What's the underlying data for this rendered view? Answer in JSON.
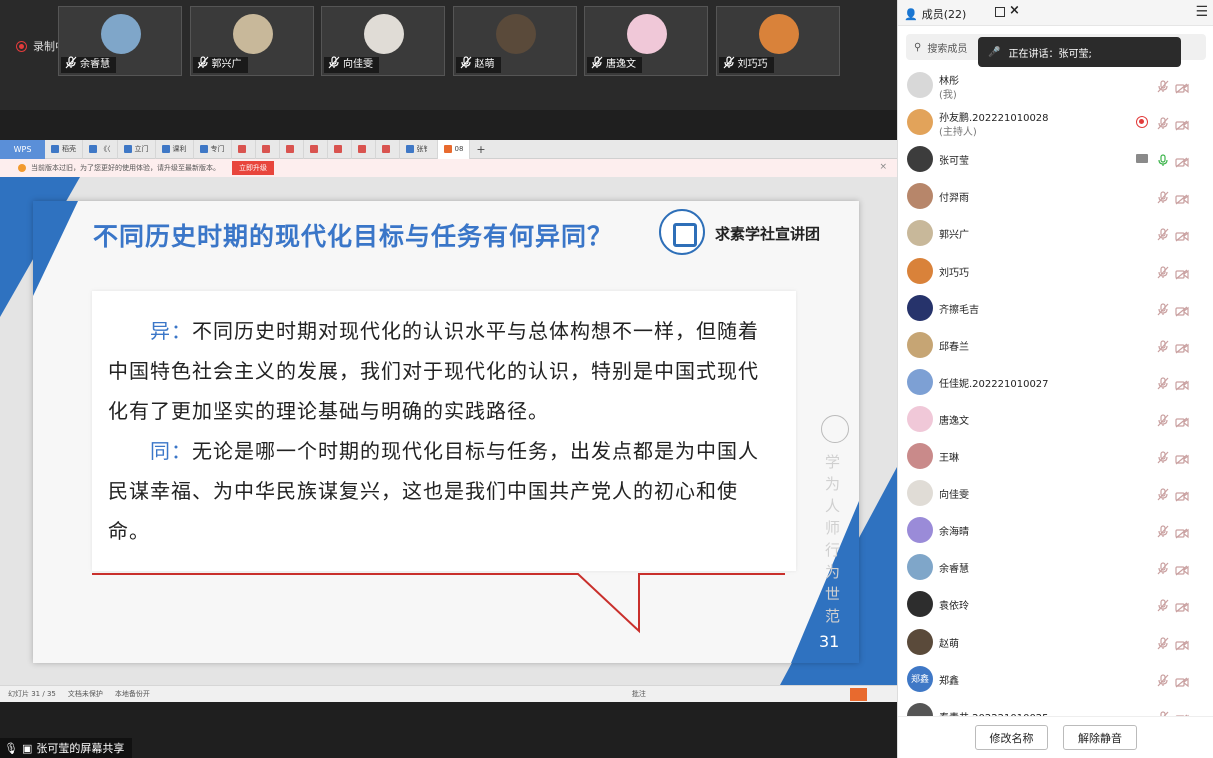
{
  "recording": {
    "label": "录制中"
  },
  "video_tiles": [
    {
      "name": "余睿慧",
      "avatar_color": "#7fa6c9"
    },
    {
      "name": "郭兴广",
      "avatar_color": "#c8b89a"
    },
    {
      "name": "向佳雯",
      "avatar_color": "#e0dcd6"
    },
    {
      "name": "赵萌",
      "avatar_color": "#5a4a3a"
    },
    {
      "name": "唐逸文",
      "avatar_color": "#f0c8d8"
    },
    {
      "name": "刘巧巧",
      "avatar_color": "#d9823a"
    }
  ],
  "wps": {
    "app_label": "WPS",
    "tabs": [
      "稻壳",
      "《〈",
      "立门",
      "课利",
      "专门",
      "",
      "",
      "",
      "",
      "",
      "",
      "",
      "张钅",
      "08"
    ],
    "update_notice": "当前版本过旧，为了您更好的使用体验，请升级至最新版本。",
    "update_button": "立即升级",
    "status_slide": "幻灯片 31 / 35",
    "status_protect": "文档未保护",
    "status_backup": "本地备份开",
    "status_notes": "批注"
  },
  "slide": {
    "title": "不同历史时期的现代化目标与任务有何异同？",
    "org_name": "求素学社宣讲团",
    "para1_kw": "异：",
    "para1_text": "不同历史时期对现代化的认识水平与总体构想不一样，但随着中国特色社会主义的发展，我们对于现代化的认识，特别是中国式现代化有了更加坚实的理论基础与明确的实践路径。",
    "para2_kw": "同：",
    "para2_text": "无论是哪一个时期的现代化目标与任务，出发点都是为中国人民谋幸福、为中华民族谋复兴，这也是我们中国共产党人的初心和使命。",
    "page_number": "31",
    "watermark": "学为人师 行为世范"
  },
  "screen_share": {
    "label": "张可莹的屏幕共享"
  },
  "panel": {
    "title": "成员(22)",
    "search_placeholder": "搜索成员",
    "speaking": "正在讲话：张可莹;",
    "members": [
      {
        "name": "林彤",
        "role": "(我)",
        "color": "#d8d8d8"
      },
      {
        "name": "孙友鹏.202221010028",
        "role": "(主持人)",
        "color": "#e2a35a",
        "recording": true
      },
      {
        "name": "张可莹",
        "role": "",
        "color": "#3c3c3c",
        "sharing": true,
        "mic_on": true
      },
      {
        "name": "付羿雨",
        "role": "",
        "color": "#b7866a"
      },
      {
        "name": "郭兴广",
        "role": "",
        "color": "#c8b89a"
      },
      {
        "name": "刘巧巧",
        "role": "",
        "color": "#d9823a"
      },
      {
        "name": "齐擦毛吉",
        "role": "",
        "color": "#26336b"
      },
      {
        "name": "邱春兰",
        "role": "",
        "color": "#c6a574"
      },
      {
        "name": "任佳妮.202221010027",
        "role": "",
        "color": "#7da0d4"
      },
      {
        "name": "唐逸文",
        "role": "",
        "color": "#f0c8d8"
      },
      {
        "name": "王琳",
        "role": "",
        "color": "#c98a8a"
      },
      {
        "name": "向佳雯",
        "role": "",
        "color": "#e0dcd6"
      },
      {
        "name": "余海晴",
        "role": "",
        "color": "#9a8bd8"
      },
      {
        "name": "余睿慧",
        "role": "",
        "color": "#7fa6c9"
      },
      {
        "name": "袁依玲",
        "role": "",
        "color": "#2d2d2d"
      },
      {
        "name": "赵萌",
        "role": "",
        "color": "#5a4a3a"
      },
      {
        "name": "郑鑫",
        "role": "",
        "color": "#3f78c6",
        "initials": "郑鑫"
      },
      {
        "name": "秦青井.202221010025",
        "role": "",
        "color": "#555"
      }
    ],
    "rename_button": "修改名称",
    "unmute_button": "解除静音"
  }
}
